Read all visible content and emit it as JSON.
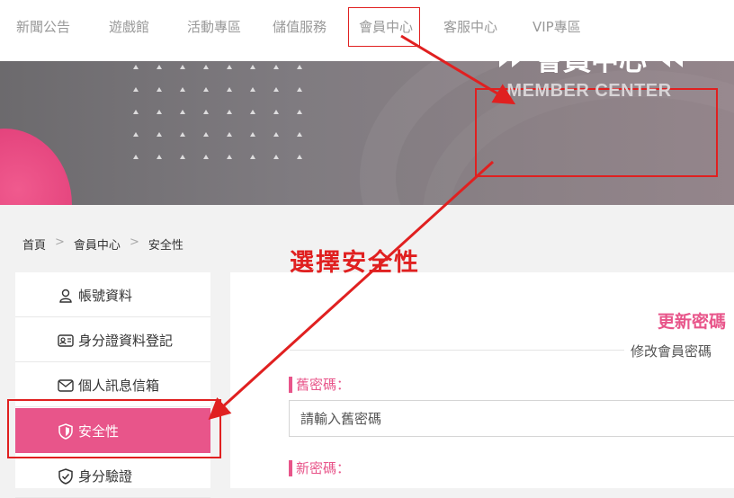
{
  "nav": {
    "items": [
      {
        "label": "新聞公告"
      },
      {
        "label": "遊戲館"
      },
      {
        "label": "活動專區"
      },
      {
        "label": "儲值服務"
      },
      {
        "label": "會員中心"
      },
      {
        "label": "客服中心"
      },
      {
        "label": "VIP專區"
      }
    ],
    "active_index": 4
  },
  "banner": {
    "title": "會員中心",
    "subtitle": "MEMBER CENTER"
  },
  "breadcrumb": {
    "items": [
      "首頁",
      "會員中心",
      "安全性"
    ],
    "separator": ">"
  },
  "sidebar": {
    "items": [
      {
        "label": "帳號資料",
        "icon": "user-icon"
      },
      {
        "label": "身分證資料登記",
        "icon": "id-card-icon"
      },
      {
        "label": "個人訊息信箱",
        "icon": "mail-icon"
      },
      {
        "label": "安全性",
        "icon": "shield-icon"
      },
      {
        "label": "身分驗證",
        "icon": "shield-check-icon"
      }
    ],
    "active_index": 3
  },
  "content": {
    "section_title": "更新密碼",
    "section_subtitle": "修改會員密碼",
    "fields": [
      {
        "label": "舊密碼：",
        "placeholder": "請輸入舊密碼"
      },
      {
        "label": "新密碼："
      }
    ]
  },
  "annotation": {
    "text": "選擇安全性"
  },
  "colors": {
    "accent": "#e8558a",
    "annotation": "#e02020",
    "nav_text": "#999999"
  }
}
